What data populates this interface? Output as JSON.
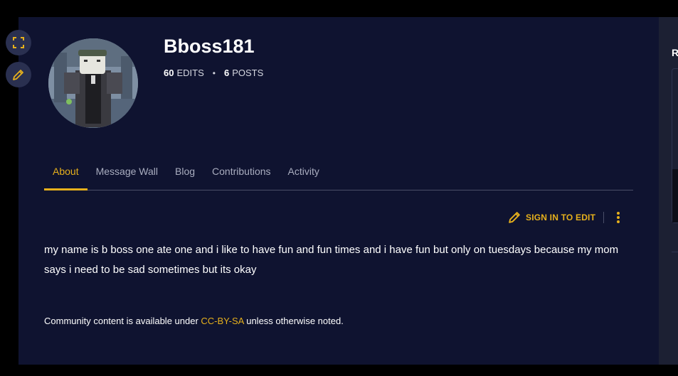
{
  "profile": {
    "username": "Bboss181",
    "edits_count": "60",
    "edits_label": "EDITS",
    "posts_count": "6",
    "posts_label": "POSTS",
    "separator": "•"
  },
  "tabs": [
    {
      "label": "About",
      "active": true
    },
    {
      "label": "Message Wall",
      "active": false
    },
    {
      "label": "Blog",
      "active": false
    },
    {
      "label": "Contributions",
      "active": false
    },
    {
      "label": "Activity",
      "active": false
    }
  ],
  "toolbar": {
    "sign_in_label": "SIGN IN TO EDIT"
  },
  "bio": {
    "text": "my name is b boss one ate one and i like to have fun and fun times and i have fun but only on tuesdays because my mom says i need to be sad sometimes but its okay"
  },
  "footer": {
    "license_prefix": "Community content is available under ",
    "license_link": "CC-BY-SA",
    "license_suffix": " unless otherwise noted."
  },
  "right_rail": {
    "heading_fragment": "R"
  },
  "colors": {
    "page_bg": "#0f1330",
    "accent": "#e6b01c",
    "text": "#ffffff",
    "muted": "#a9adbf"
  },
  "icons": {
    "expand": "expand-icon",
    "edit": "pencil-icon",
    "more": "more-vertical-icon"
  }
}
